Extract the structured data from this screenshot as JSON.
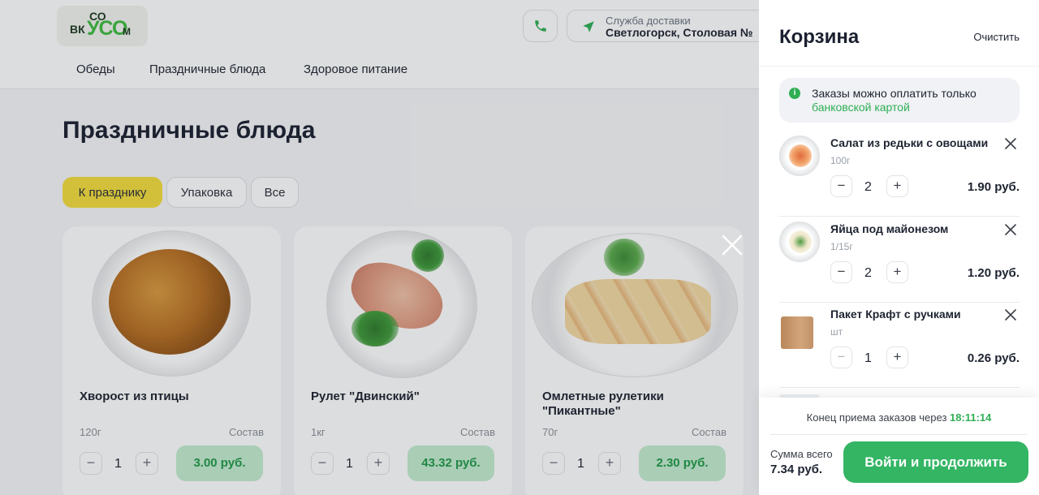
{
  "header": {
    "logo": {
      "line1": "СО",
      "line2": "ВК",
      "line3": "УСО",
      "line4": "М"
    },
    "delivery": {
      "label": "Служба доставки",
      "address": "Светлогорск, Столовая №"
    }
  },
  "nav": [
    "Обеды",
    "Праздничные блюда",
    "Здоровое питание"
  ],
  "page": {
    "title": "Праздничные блюда",
    "filters": [
      "К празднику",
      "Упаковка",
      "Все"
    ],
    "active_filter": "К празднику"
  },
  "products": [
    {
      "name": "Хворост из птицы",
      "weight": "120г",
      "composition": "Состав",
      "qty": "1",
      "price": "3.00 руб."
    },
    {
      "name": "Рулет \"Двинский\"",
      "weight": "1кг",
      "composition": "Состав",
      "qty": "1",
      "price": "43.32 руб."
    },
    {
      "name": "Омлетные рулетики \"Пикантные\"",
      "weight": "70г",
      "composition": "Состав",
      "qty": "1",
      "price": "2.30 руб."
    }
  ],
  "cart": {
    "title": "Корзина",
    "clear_label": "Очистить",
    "info_line1": "Заказы можно оплатить только",
    "info_line2": "банковской картой",
    "items": [
      {
        "name": "Салат из редьки с овощами",
        "unit": "100г",
        "qty": "2",
        "price": "1.90 руб."
      },
      {
        "name": "Яйца под майонезом",
        "unit": "1/15г",
        "qty": "2",
        "price": "1.20 руб."
      },
      {
        "name": "Пакет Крафт с ручками",
        "unit": "шт",
        "qty": "1",
        "price": "0.26 руб."
      }
    ],
    "deadline_label": "Конец приема заказов через",
    "deadline_time": "18:11:14",
    "total_label": "Сумма всего",
    "total_value": "7.34 руб.",
    "checkout_label": "Войти и продолжить"
  },
  "colors": {
    "accent_green": "#33b563",
    "chip_active": "#f5dd3c",
    "price_bg": "#c4ecd0"
  },
  "icons": [
    "phone-icon",
    "location-arrow-icon",
    "close-icon",
    "info-icon",
    "remove-icon"
  ]
}
